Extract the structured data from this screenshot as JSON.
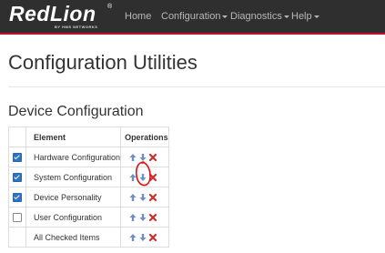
{
  "brand": {
    "name": "RedLion",
    "registered": "®",
    "subtitle": "BY HMS NETWORKS"
  },
  "nav": {
    "items": [
      {
        "label": "Home",
        "has_caret": false
      },
      {
        "label": "Configuration",
        "has_caret": true
      },
      {
        "label": "Diagnostics",
        "has_caret": true
      },
      {
        "label": "Help",
        "has_caret": true
      }
    ]
  },
  "page": {
    "title": "Configuration Utilities"
  },
  "device_config": {
    "title": "Device Configuration",
    "columns": {
      "element": "Element",
      "operations": "Operations"
    },
    "rows": [
      {
        "checked": true,
        "element": "Hardware Configuration"
      },
      {
        "checked": true,
        "element": "System Configuration"
      },
      {
        "checked": true,
        "element": "Device Personality"
      },
      {
        "checked": false,
        "element": "User Configuration"
      },
      {
        "checked": null,
        "element": "All Checked Items"
      }
    ]
  },
  "icons": {
    "upload": "arrow-up-icon",
    "download": "arrow-down-icon",
    "delete": "delete-x-icon"
  },
  "colors": {
    "navbar": "#2f2f2f",
    "accent_red": "#c8102e",
    "arrow_blue": "#6f8fc0",
    "delete_red": "#c9302c",
    "annotation_red": "#e01010"
  }
}
